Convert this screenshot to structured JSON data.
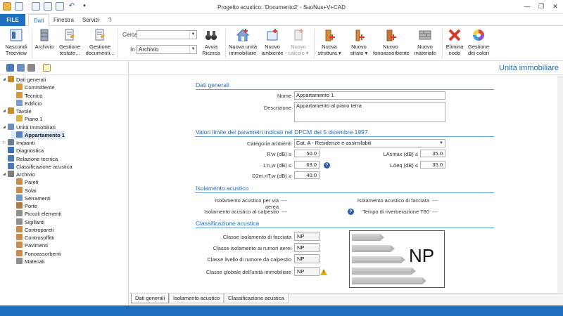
{
  "window": {
    "title": "Progetto acustico: 'Documento2' - SuoNus+V+CAD",
    "minimize": "—",
    "restore": "❐",
    "close": "✕"
  },
  "menu": {
    "file": "FILE",
    "tabs": [
      "Dati",
      "Finestra",
      "Servizi"
    ],
    "help": "?"
  },
  "ribbon": {
    "buttons": [
      {
        "label": "Nascondi\nTreeview"
      },
      {
        "label": "Archivio"
      },
      {
        "label": "Gestione\ntestate..."
      },
      {
        "label": "Gestione\ndocumenti..."
      },
      {
        "label": "Avvia\nRicerca"
      },
      {
        "label": "Nuova unità\nimmobiliare"
      },
      {
        "label": "Nuovo\nambiente"
      },
      {
        "label": "Nuovo\ncalcolo ▾"
      },
      {
        "label": "Nuova\nstruttura ▾"
      },
      {
        "label": "Nuovo\nstrato ▾"
      },
      {
        "label": "Nuovo\nfonoassorbente"
      },
      {
        "label": "Nuovo\nmateriale"
      },
      {
        "label": "Elimina\nnodo"
      },
      {
        "label": "Gestione\ndei colori"
      }
    ],
    "cerca_label": "Cerca",
    "cerca_value": "",
    "in_label": "In",
    "in_value": "Archivio"
  },
  "tree": [
    {
      "label": "Dati generali",
      "level": 0,
      "toggle": "◢",
      "icon_color": "#c78b2b",
      "icon": "folder-icon"
    },
    {
      "label": "Committente",
      "level": 1,
      "toggle": "",
      "icon_color": "#d29a3d",
      "icon": "person-icon"
    },
    {
      "label": "Tecnico",
      "level": 1,
      "toggle": "",
      "icon_color": "#d29a3d",
      "icon": "person-icon"
    },
    {
      "label": "Edificio",
      "level": 1,
      "toggle": "",
      "icon_color": "#7a9ccf",
      "icon": "building-icon"
    },
    {
      "label": "Tavole",
      "level": 0,
      "toggle": "◢",
      "icon_color": "#c78b2b",
      "icon": "folder-icon"
    },
    {
      "label": "Piano 1",
      "level": 1,
      "toggle": "",
      "icon_color": "#d9b24a",
      "icon": "pencil-icon"
    },
    {
      "label": "Unità Immobiliari",
      "level": 0,
      "toggle": "◢",
      "icon_color": "#6d8fc0",
      "icon": "house-icon"
    },
    {
      "label": "Appartamento 1",
      "level": 1,
      "toggle": "",
      "icon_color": "#5b7fbd",
      "icon": "house-icon",
      "selected": true
    },
    {
      "label": "Impianti",
      "level": 0,
      "toggle": "▷",
      "icon_color": "#6c7e95",
      "icon": "gear-icon"
    },
    {
      "label": "Diagnostica",
      "level": 0,
      "toggle": "",
      "icon_color": "#3d6fb6",
      "icon": "diagnostic-icon"
    },
    {
      "label": "Relazione tecnica",
      "level": 0,
      "toggle": "",
      "icon_color": "#4a78b8",
      "icon": "document-icon"
    },
    {
      "label": "Classificazione acustica",
      "level": 0,
      "toggle": "",
      "icon_color": "#4a78b8",
      "icon": "document-icon"
    },
    {
      "label": "Archivio",
      "level": 0,
      "toggle": "◢",
      "icon_color": "#7e7e7e",
      "icon": "archive-icon"
    },
    {
      "label": "Pareti",
      "level": 1,
      "toggle": "",
      "icon_color": "#c98a4e",
      "icon": "wall-icon"
    },
    {
      "label": "Solai",
      "level": 1,
      "toggle": "",
      "icon_color": "#c98a4e",
      "icon": "slab-icon"
    },
    {
      "label": "Serramenti",
      "level": 1,
      "toggle": "",
      "icon_color": "#6e96c8",
      "icon": "window-icon"
    },
    {
      "label": "Porte",
      "level": 1,
      "toggle": "",
      "icon_color": "#b27a45",
      "icon": "door-icon"
    },
    {
      "label": "Piccoli elementi",
      "level": 1,
      "toggle": "",
      "icon_color": "#8f8f8f",
      "icon": "element-icon"
    },
    {
      "label": "Sigillanti",
      "level": 1,
      "toggle": "",
      "icon_color": "#8f8f8f",
      "icon": "sealant-icon"
    },
    {
      "label": "Contropareti",
      "level": 1,
      "toggle": "",
      "icon_color": "#c98a4e",
      "icon": "wall-icon"
    },
    {
      "label": "Controsoffitti",
      "level": 1,
      "toggle": "",
      "icon_color": "#c98a4e",
      "icon": "ceiling-icon"
    },
    {
      "label": "Pavimenti",
      "level": 1,
      "toggle": "",
      "icon_color": "#c98a4e",
      "icon": "floor-icon"
    },
    {
      "label": "Fonoassorbenti",
      "level": 1,
      "toggle": "",
      "icon_color": "#c98a4e",
      "icon": "absorber-icon"
    },
    {
      "label": "Materiali",
      "level": 1,
      "toggle": "",
      "icon_color": "#8f8f8f",
      "icon": "material-icon"
    }
  ],
  "main": {
    "title": "Unità immobiliare",
    "dati_generali": {
      "title": "Dati generali",
      "nome_label": "Nome",
      "nome_value": "Appartamento 1",
      "descrizione_label": "Descrizione",
      "descrizione_value": "Appartamento al piano terra"
    },
    "valori": {
      "title": "Valori limite dei parametri indicati nel DPCM del 5 dicembre 1997",
      "categoria_label": "Categoria ambienti",
      "categoria_value": "Cat. A - Residenze e assimilabili",
      "rw_label": "R'w (dB) ≥",
      "rw_value": "50.0",
      "lnw_label": "L'n,w (dB) ≤",
      "lnw_value": "63.0",
      "d2m_label": "D2m,nT,w (dB) ≥",
      "d2m_value": "40.0",
      "lasmax_label": "LAsmax (dB) ≤",
      "lasmax_value": "35.0",
      "laeq_label": "LAeq (dB) ≤",
      "laeq_value": "35.0"
    },
    "isolamento": {
      "title": "Isolamento acustico",
      "aerea_label": "Isolamento acustico per via aerea",
      "aerea_value": "---",
      "facciata_label": "Isolamento acustico di facciata",
      "facciata_value": "---",
      "calpestio_label": "Isolamento acustico al calpestio",
      "calpestio_value": "---",
      "riverberazione_label": "Tempo di riverberazione T60",
      "riverberazione_value": "---"
    },
    "classificazione": {
      "title": "Classificazione acustica",
      "rows": [
        {
          "label": "Classe isolamento di facciata",
          "value": "NP"
        },
        {
          "label": "Classe isolamento ai rumori aerei",
          "value": "NP"
        },
        {
          "label": "Classe livello di rumore da calpestio",
          "value": "NP"
        },
        {
          "label": "Classe globale dell'unità immobiliare",
          "value": "NP"
        }
      ],
      "graph_value": "NP"
    },
    "bottom_tabs": [
      "Dati generali",
      "Isolamento acustico",
      "Classificazione acustica"
    ]
  },
  "colors": {
    "accent": "#1e6fbf",
    "section_line": "#6b9bd1",
    "warning": "#e8b400"
  }
}
